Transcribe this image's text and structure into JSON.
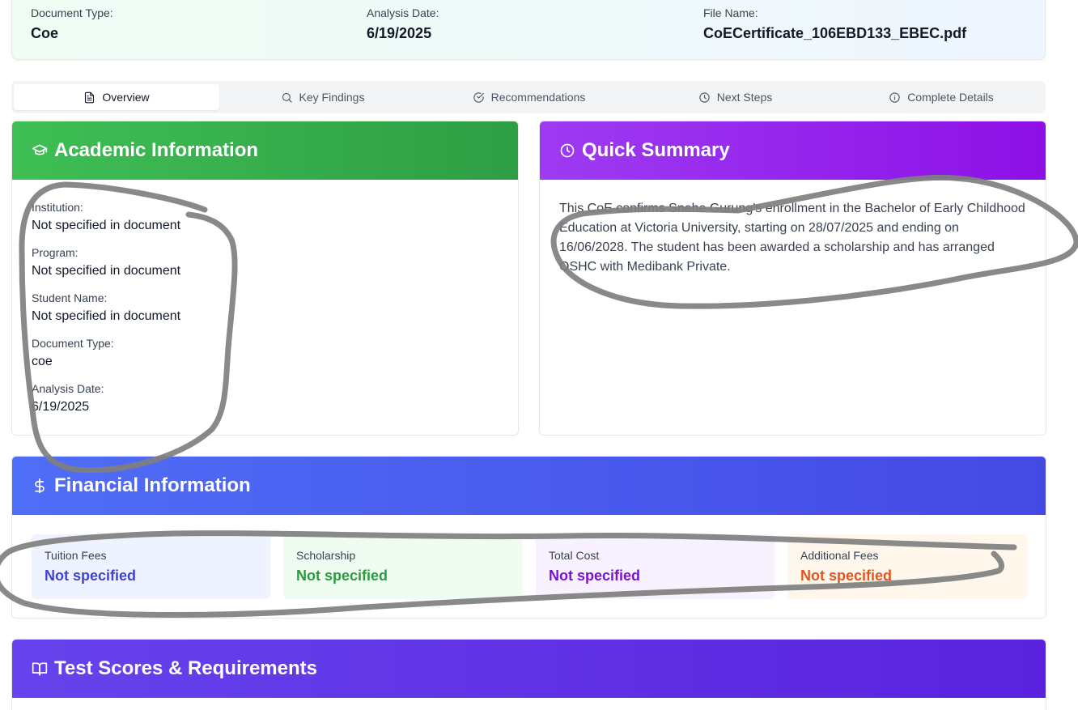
{
  "header": {
    "doc_type_label": "Document Type:",
    "doc_type_value": "Coe",
    "analysis_date_label": "Analysis Date:",
    "analysis_date_value": "6/19/2025",
    "file_name_label": "File Name:",
    "file_name_value": "CoECertificate_106EBD133_EBEC.pdf"
  },
  "tabs": [
    {
      "label": "Overview",
      "icon": "file-text-icon",
      "active": true
    },
    {
      "label": "Key Findings",
      "icon": "search-icon",
      "active": false
    },
    {
      "label": "Recommendations",
      "icon": "check-circle-icon",
      "active": false
    },
    {
      "label": "Next Steps",
      "icon": "clock-icon",
      "active": false
    },
    {
      "label": "Complete Details",
      "icon": "info-icon",
      "active": false
    }
  ],
  "academic": {
    "title": "Academic Information",
    "icon": "graduation-cap-icon",
    "fields": [
      {
        "label": "Institution:",
        "value": "Not specified in document"
      },
      {
        "label": "Program:",
        "value": "Not specified in document"
      },
      {
        "label": "Student Name:",
        "value": "Not specified in document"
      },
      {
        "label": "Document Type:",
        "value": "coe"
      },
      {
        "label": "Analysis Date:",
        "value": "6/19/2025"
      }
    ]
  },
  "quick_summary": {
    "title": "Quick Summary",
    "icon": "clock-icon",
    "text": "This CoE confirms Snehe Gurung's enrollment in the Bachelor of Early Childhood Education at Victoria University, starting on 28/07/2025 and ending on 16/06/2028. The student has been awarded a scholarship and has arranged OSHC with Medibank Private."
  },
  "financial": {
    "title": "Financial Information",
    "icon": "dollar-icon",
    "items": [
      {
        "label": "Tuition Fees",
        "value": "Not specified",
        "bg": "#eef3ff",
        "color": "#4043cf"
      },
      {
        "label": "Scholarship",
        "value": "Not specified",
        "bg": "#effcf2",
        "color": "#2c9a3e"
      },
      {
        "label": "Total Cost",
        "value": "Not specified",
        "bg": "#f7f2fe",
        "color": "#7a12d1"
      },
      {
        "label": "Additional Fees",
        "value": "Not specified",
        "bg": "#fff6ec",
        "color": "#e0561c"
      }
    ]
  },
  "tests": {
    "title": "Test Scores & Requirements",
    "icon": "book-open-icon"
  }
}
